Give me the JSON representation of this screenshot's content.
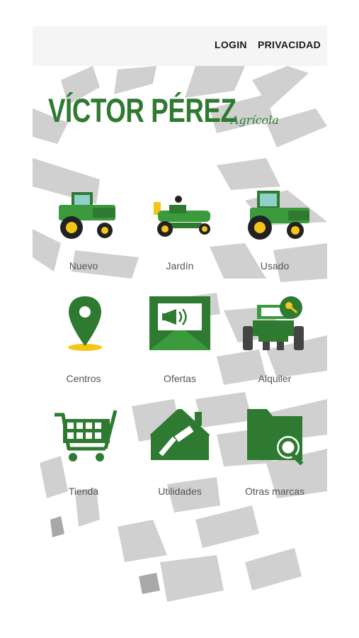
{
  "header": {
    "login": "LOGIN",
    "privacy": "PRIVACIDAD"
  },
  "logo": {
    "main": "VÍCTOR PÉREZ",
    "sub": "Agrícola"
  },
  "menu": [
    {
      "label": "Nuevo",
      "icon": "new-tractor-icon"
    },
    {
      "label": "Jardín",
      "icon": "lawn-tractor-icon"
    },
    {
      "label": "Usado",
      "icon": "used-tractor-icon"
    },
    {
      "label": "Centros",
      "icon": "location-pin-icon"
    },
    {
      "label": "Ofertas",
      "icon": "offers-envelope-icon"
    },
    {
      "label": "Alquiler",
      "icon": "rental-tractor-key-icon"
    },
    {
      "label": "Tienda",
      "icon": "shopping-cart-icon"
    },
    {
      "label": "Utilidades",
      "icon": "tools-house-icon"
    },
    {
      "label": "Otras marcas",
      "icon": "folder-search-icon"
    }
  ],
  "colors": {
    "brand_green": "#2f7a31",
    "tractor_yellow": "#f5c518",
    "track_gray": "#cfcfcf"
  }
}
